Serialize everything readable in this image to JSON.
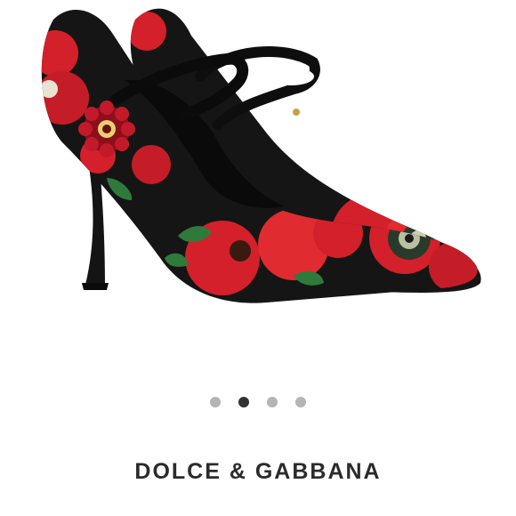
{
  "product_image": {
    "icon": "floral-mary-jane-pump-image",
    "colors": {
      "shoe": "#151515",
      "flower": "#d3202a",
      "leaf": "#2f7a3a",
      "jewel": "#c21a2a"
    }
  },
  "carousel": {
    "total": 4,
    "active_index": 1,
    "colors": {
      "active": "#333333",
      "inactive": "#b5b5b5"
    }
  },
  "brand": {
    "name": "DOLCE & GABBANA"
  }
}
